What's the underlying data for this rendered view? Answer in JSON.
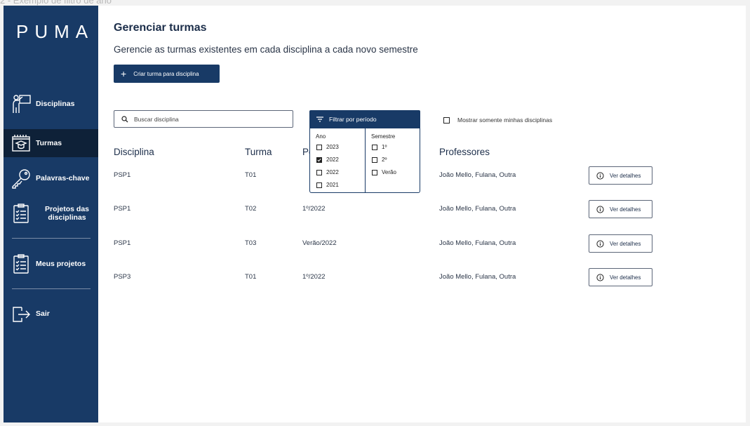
{
  "frame_label": "2 - Exemplo de filtro de ano",
  "sidebar": {
    "logo": "PUMA",
    "items": [
      {
        "label": "Disciplinas",
        "icon": "teacher-board-icon"
      },
      {
        "label": "Turmas",
        "icon": "classroom-cap-icon",
        "active": true
      },
      {
        "label": "Palavras-chave",
        "icon": "key-icon"
      },
      {
        "label": "Projetos das disciplinas",
        "icon": "clipboard-list-icon"
      },
      {
        "label": "Meus projetos",
        "icon": "clipboard-list-icon"
      },
      {
        "label": "Sair",
        "icon": "logout-icon"
      }
    ]
  },
  "header": {
    "title": "Gerenciar turmas",
    "subtitle": "Gerencie as turmas existentes em cada disciplina a cada novo semestre",
    "create_label": "Criar turma para disciplina"
  },
  "search": {
    "placeholder": "Buscar disciplina"
  },
  "filter": {
    "button_label": "Filtrar por período",
    "year_header": "Ano",
    "semester_header": "Semestre",
    "years": [
      {
        "label": "2023",
        "checked": false
      },
      {
        "label": "2022",
        "checked": true
      },
      {
        "label": "2022",
        "checked": false
      },
      {
        "label": "2021",
        "checked": false
      }
    ],
    "semesters": [
      {
        "label": "1º",
        "checked": false
      },
      {
        "label": "2º",
        "checked": false
      },
      {
        "label": "Verão",
        "checked": false
      }
    ]
  },
  "mine_label": "Mostrar somente minhas disciplinas",
  "table": {
    "headers": [
      "Disciplina",
      "Turma",
      "Período",
      "Professores"
    ],
    "detail_label": "Ver detalhes",
    "rows": [
      {
        "disciplina": "PSP1",
        "turma": "T01",
        "periodo": "",
        "professores": "João Mello, Fulana, Outra"
      },
      {
        "disciplina": "PSP1",
        "turma": "T02",
        "periodo": "1º/2022",
        "professores": "João Mello, Fulana, Outra"
      },
      {
        "disciplina": "PSP1",
        "turma": "T03",
        "periodo": "Verão/2022",
        "professores": "João Mello, Fulana, Outra"
      },
      {
        "disciplina": "PSP3",
        "turma": "T01",
        "periodo": "1º/2022",
        "professores": "João Mello, Fulana, Outra"
      }
    ]
  }
}
